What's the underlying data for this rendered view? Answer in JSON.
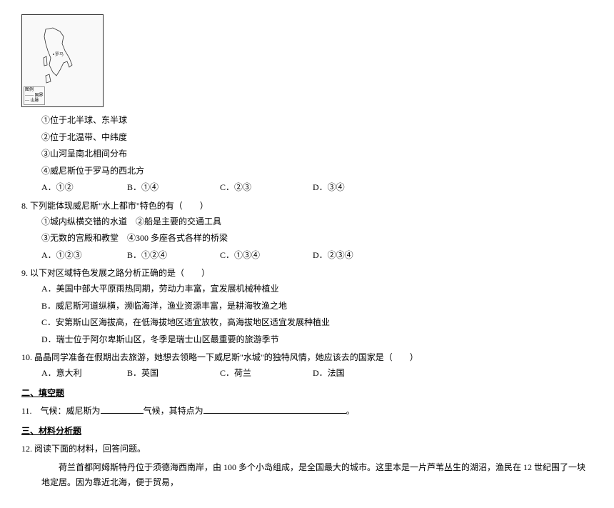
{
  "map": {
    "legend_title": "图例",
    "legend_items": [
      "—— 国界",
      "— 山脉"
    ]
  },
  "q_intro": {
    "opt1": "①位于北半球、东半球",
    "opt2": "②位于北温带、中纬度",
    "opt3": "③山河呈南北相间分布",
    "opt4": "④威尼斯位于罗马的西北方",
    "choices": {
      "a": "A．①②",
      "b": "B．①④",
      "c": "C．②③",
      "d": "D．③④"
    }
  },
  "q8": {
    "stem": "8. 下列能体现威尼斯\"水上都市\"特色的有（　　）",
    "opt1": "①城内纵横交错的水道　②船是主要的交通工具",
    "opt2": "③无数的宫殿和教堂　④300 多座各式各样的桥梁",
    "choices": {
      "a": "A．①②③",
      "b": "B．①②④",
      "c": "C．①③④",
      "d": "D．②③④"
    }
  },
  "q9": {
    "stem": "9. 以下对区域特色发展之路分析正确的是（　　）",
    "a": "A．美国中部大平原雨热同期，劳动力丰富，宜发展机械种植业",
    "b": "B．威尼斯河道纵横，濒临海洋，渔业资源丰富，是耕海牧渔之地",
    "c": "C．安第斯山区海拔高，在低海拔地区适宜放牧，高海拔地区适宜发展种植业",
    "d": "D．瑞士位于阿尔卑斯山区，冬季是瑞士山区最重要的旅游季节"
  },
  "q10": {
    "stem": "10. 晶晶同学准备在假期出去旅游，她想去领略一下威尼斯\"水城\"的独特风情，她应该去的国家是（　　）",
    "choices": {
      "a": "A．意大利",
      "b": "B．英国",
      "c": "C．荷兰",
      "d": "D．法国"
    }
  },
  "section2": {
    "header": "二、填空题",
    "q11_pre": "11.　气候：威尼斯为",
    "q11_mid": "气候，其特点为",
    "q11_end": "。"
  },
  "section3": {
    "header": "三、材料分析题",
    "q12_stem": "12. 阅读下面的材料，回答问题。",
    "q12_material": "荷兰首都阿姆斯特丹位于须德海西南岸，由 100 多个小岛组成，是全国最大的城市。这里本是一片芦苇丛生的湖沼，渔民在 12 世纪围了一块地定居。因为靠近北海，便于贸易，"
  }
}
